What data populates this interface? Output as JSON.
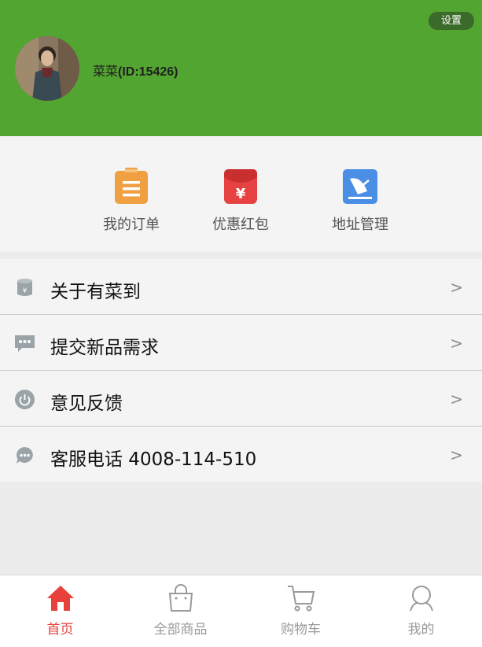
{
  "header": {
    "settings_label": "设置",
    "username": "菜菜",
    "user_id": "(ID:15426)"
  },
  "quick_actions": [
    {
      "label": "我的订单",
      "icon": "clipboard-icon",
      "color": "#f0a040"
    },
    {
      "label": "优惠红包",
      "icon": "red-envelope-icon",
      "color": "#e64242"
    },
    {
      "label": "地址管理",
      "icon": "map-icon",
      "color": "#4a8ee6"
    }
  ],
  "menu": [
    {
      "label": "关于有菜到",
      "icon": "info-cylinder-icon"
    },
    {
      "label": "提交新品需求",
      "icon": "message-icon"
    },
    {
      "label": "意见反馈",
      "icon": "power-icon"
    },
    {
      "label": "客服电话 4008-114-510",
      "icon": "chat-bubble-icon"
    }
  ],
  "chevron": ">",
  "tabs": [
    {
      "label": "首页",
      "icon": "home-icon",
      "active": true
    },
    {
      "label": "全部商品",
      "icon": "shopping-bag-icon",
      "active": false
    },
    {
      "label": "购物车",
      "icon": "cart-icon",
      "active": false
    },
    {
      "label": "我的",
      "icon": "user-icon",
      "active": false
    }
  ],
  "colors": {
    "brand_green": "#53a531",
    "active_red": "#e8403b"
  }
}
